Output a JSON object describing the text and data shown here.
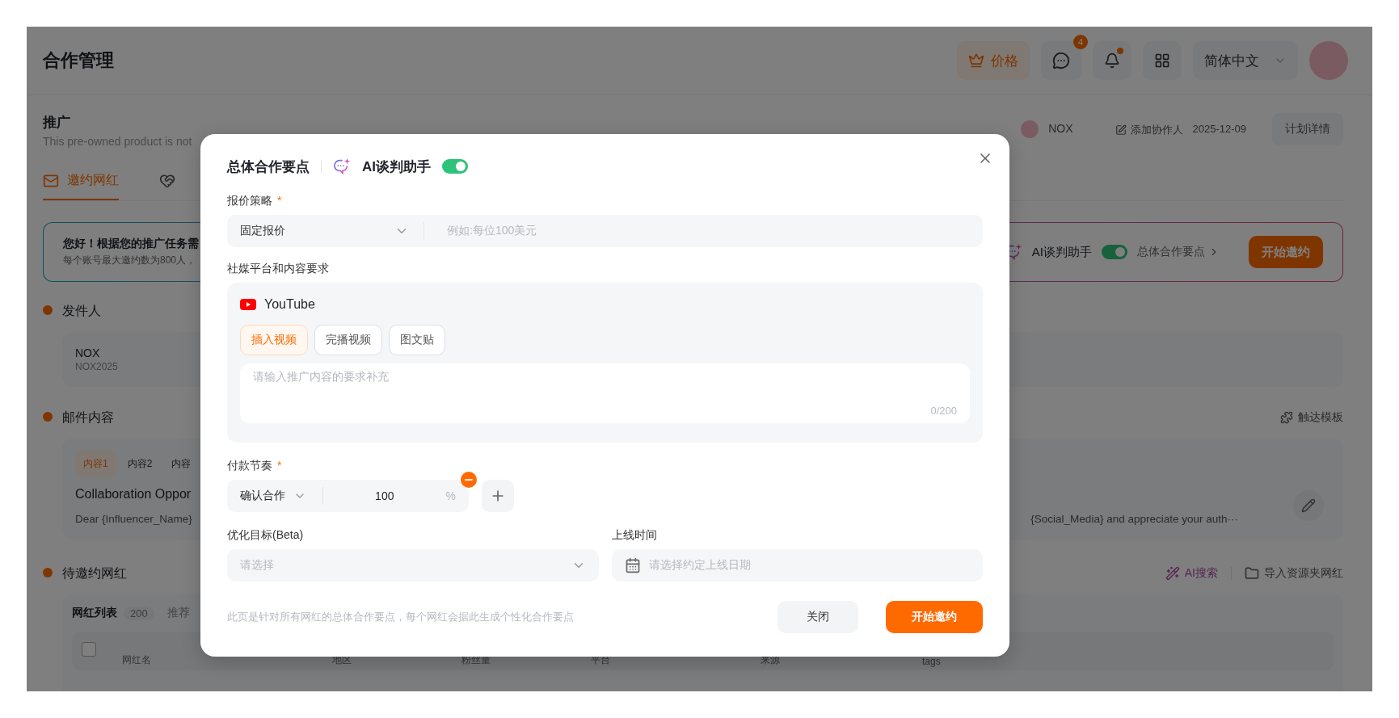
{
  "app": {
    "title": "合作管理",
    "price_button": "价格",
    "message_badge": "4",
    "bell_dot": true,
    "language": "简体中文"
  },
  "plan": {
    "title": "推广",
    "subtitle": "This pre-owned product is not",
    "owner": "NOX",
    "add_collaborator": "添加协作人",
    "date": "2025-12-09",
    "details_button": "计划详情"
  },
  "tabs": [
    {
      "label": "邀约网红",
      "selected": true
    }
  ],
  "banner": {
    "greeting": "您好！根据您的推广任务需",
    "note": "每个账号最大邀约数为800人，",
    "ai_label": "AI谈判助手",
    "ai_on": true,
    "points_link": "总体合作要点",
    "start_button": "开始邀约"
  },
  "sender": {
    "title": "发件人",
    "name": "NOX",
    "account": "NOX2025"
  },
  "email": {
    "title": "邮件内容",
    "template_link": "触达模板",
    "tabs": [
      {
        "label": "内容1",
        "selected": true
      },
      {
        "label": "内容2",
        "selected": false
      },
      {
        "label": "内容",
        "selected": false
      }
    ],
    "subject": "Collaboration Oppor",
    "body_start": "Dear {Influencer_Name}",
    "body_end": "{Social_Media} and appreciate your auth···"
  },
  "influencers": {
    "title": "待邀约网红",
    "ai_search": "AI搜索",
    "import": "导入资源夹网红",
    "list_tab": "网红列表",
    "count": "200",
    "recommend": "推荐",
    "select_all_checked": false,
    "columns": [
      "网红名",
      "地区",
      "粉丝量",
      "平台",
      "来源",
      "tags"
    ]
  },
  "modal": {
    "title": "总体合作要点",
    "ai_label": "AI谈判助手",
    "ai_on": true,
    "pricing": {
      "label": "报价策略",
      "required_mark": "*",
      "value": "固定报价",
      "placeholder": "例如:每位100美元"
    },
    "content": {
      "label": "社媒平台和内容要求",
      "platform": "YouTube",
      "formats": [
        {
          "label": "插入视频",
          "selected": true
        },
        {
          "label": "完播视频",
          "selected": false
        },
        {
          "label": "图文贴",
          "selected": false
        }
      ],
      "placeholder": "请输入推广内容的要求补充",
      "counter": "0/200"
    },
    "payment": {
      "label": "付款节奏",
      "required_mark": "*",
      "stages": [
        {
          "stage": "确认合作",
          "value": "100",
          "unit": "%"
        }
      ]
    },
    "goal": {
      "label": "优化目标(Beta)",
      "placeholder": "请选择"
    },
    "launch": {
      "label": "上线时间",
      "placeholder": "请选择约定上线日期"
    },
    "footer_note": "此页是针对所有网红的总体合作要点，每个网红会据此生成个性化合作要点",
    "buttons": [
      {
        "label": "关闭",
        "kind": "secondary"
      },
      {
        "label": "开始邀约",
        "kind": "primary"
      }
    ]
  }
}
